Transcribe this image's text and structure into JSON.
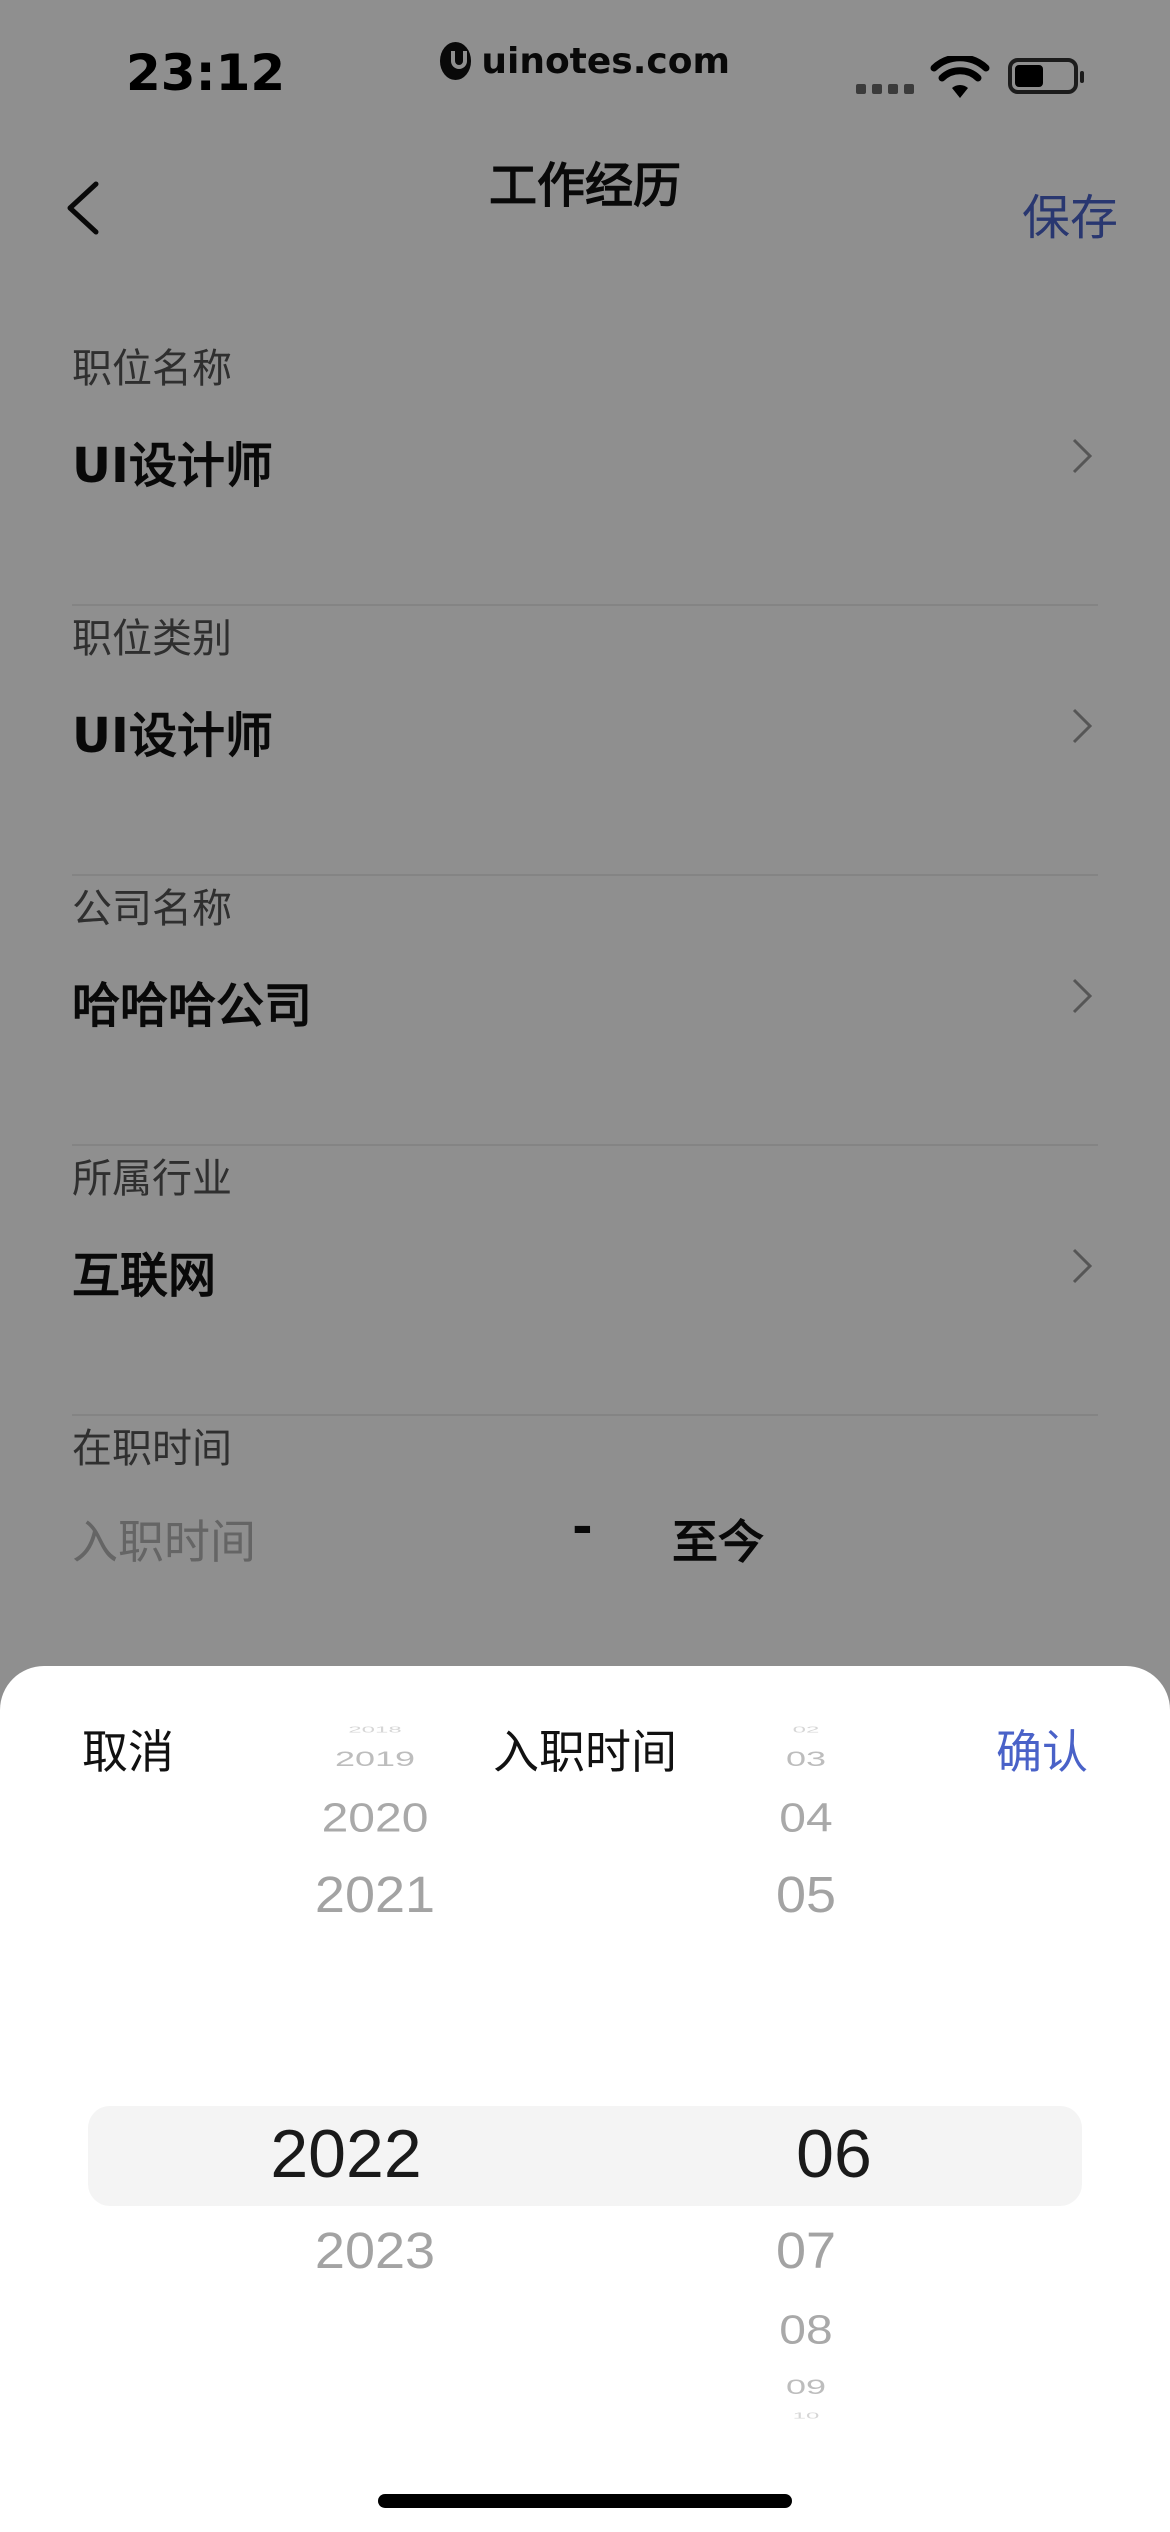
{
  "status_bar": {
    "time": "23:12",
    "site_badge": "uinotes.com"
  },
  "nav": {
    "title": "工作经历",
    "save_label": "保存"
  },
  "fields": [
    {
      "label": "职位名称",
      "value": "UI设计师"
    },
    {
      "label": "职位类别",
      "value": "UI设计师"
    },
    {
      "label": "公司名称",
      "value": "哈哈哈公司"
    },
    {
      "label": "所属行业",
      "value": "互联网"
    }
  ],
  "tenure": {
    "label": "在职时间",
    "start_placeholder": "入职时间",
    "separator": "-",
    "end_value": "至今"
  },
  "sheet": {
    "cancel_label": "取消",
    "title": "入职时间",
    "confirm_label": "确认",
    "years": [
      "2018",
      "2019",
      "2020",
      "2021",
      "2022",
      "2023"
    ],
    "selected_year": "2022",
    "months": [
      "02",
      "03",
      "04",
      "05",
      "06",
      "07",
      "08",
      "09",
      "10"
    ],
    "selected_month": "06"
  },
  "colors": {
    "accent": "#4a62c8",
    "highlight": "#f4f4f4",
    "overlay": "rgba(0,0,0,0.44)"
  }
}
